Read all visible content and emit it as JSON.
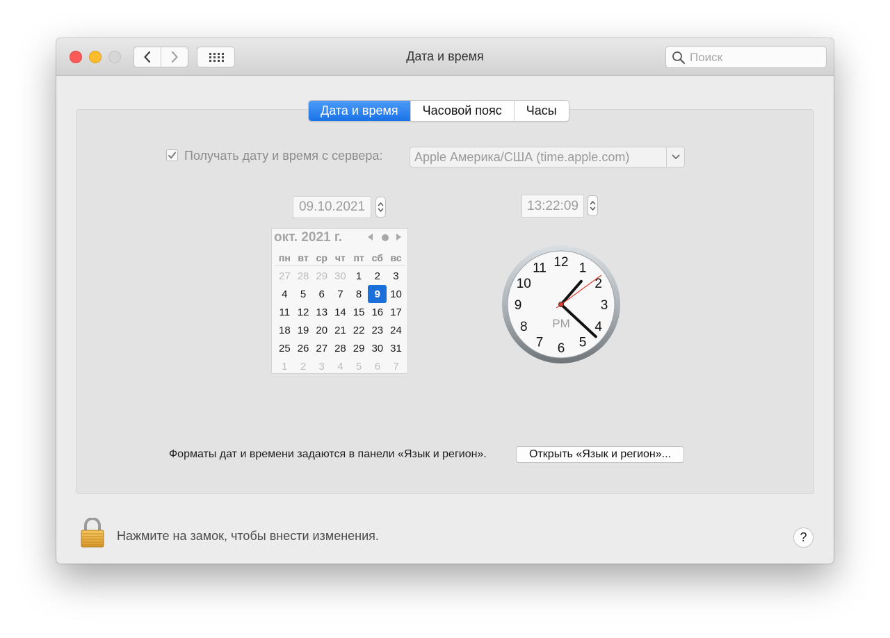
{
  "window": {
    "title": "Дата и время"
  },
  "toolbar": {
    "back_label": "Назад",
    "forward_label": "Вперёд"
  },
  "search": {
    "placeholder": "Поиск",
    "value": ""
  },
  "tabs": [
    {
      "label": "Дата и время",
      "active": true
    },
    {
      "label": "Часовой пояс",
      "active": false
    },
    {
      "label": "Часы",
      "active": false
    }
  ],
  "server_sync": {
    "checked": true,
    "label": "Получать дату и время с сервера:",
    "server": "Apple Америка/США (time.apple.com)"
  },
  "date_field": {
    "value": "09.10.2021"
  },
  "time_field": {
    "value": "13:22:09"
  },
  "calendar": {
    "title": "окт. 2021 г.",
    "weekdays": [
      "пн",
      "вт",
      "ср",
      "чт",
      "пт",
      "сб",
      "вс"
    ],
    "weeks": [
      [
        "27",
        "28",
        "29",
        "30",
        "1",
        "2",
        "3"
      ],
      [
        "4",
        "5",
        "6",
        "7",
        "8",
        "9",
        "10"
      ],
      [
        "11",
        "12",
        "13",
        "14",
        "15",
        "16",
        "17"
      ],
      [
        "18",
        "19",
        "20",
        "21",
        "22",
        "23",
        "24"
      ],
      [
        "25",
        "26",
        "27",
        "28",
        "29",
        "30",
        "31"
      ],
      [
        "1",
        "2",
        "3",
        "4",
        "5",
        "6",
        "7"
      ]
    ],
    "muted_cells": [
      [
        0,
        0
      ],
      [
        0,
        1
      ],
      [
        0,
        2
      ],
      [
        0,
        3
      ],
      [
        5,
        0
      ],
      [
        5,
        1
      ],
      [
        5,
        2
      ],
      [
        5,
        3
      ],
      [
        5,
        4
      ],
      [
        5,
        5
      ],
      [
        5,
        6
      ]
    ],
    "selected_cell": [
      1,
      5
    ]
  },
  "clock": {
    "numbers": [
      "12",
      "1",
      "2",
      "3",
      "4",
      "5",
      "6",
      "7",
      "8",
      "9",
      "10",
      "11"
    ],
    "period": "PM",
    "hours": 13,
    "minutes": 22,
    "seconds": 9
  },
  "footer": {
    "format_note": "Форматы дат и времени задаются в панели «Язык и регион».",
    "open_button": "Открыть «Язык и регион»..."
  },
  "lock": {
    "text": "Нажмите на замок, чтобы внести изменения."
  },
  "help": {
    "label": "?"
  },
  "colors": {
    "accent": "#1a73e8",
    "close": "#fc5b57",
    "minimize": "#fdbc2e",
    "zoom": "#d6d6d6"
  }
}
